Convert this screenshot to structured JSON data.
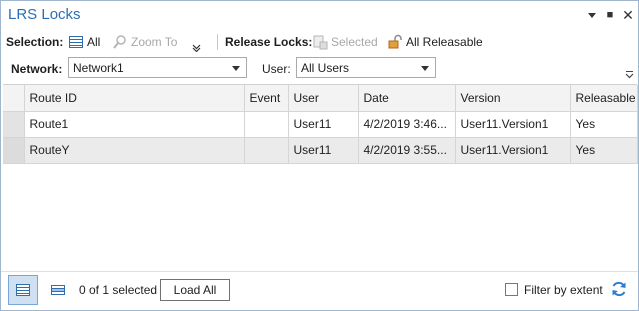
{
  "window": {
    "title": "LRS Locks",
    "pin_glyph": "▾",
    "restore_glyph": "■",
    "close_glyph": "✕"
  },
  "toolbar": {
    "selection_label": "Selection:",
    "all_label": "All",
    "zoom_to_label": "Zoom To",
    "release_locks_label": "Release Locks:",
    "selected_label": "Selected",
    "all_releasable_label": "All Releasable"
  },
  "filters": {
    "network_label": "Network:",
    "network_value": "Network1",
    "user_label": "User:",
    "user_value": "All Users"
  },
  "table": {
    "columns": [
      "Route ID",
      "Event",
      "User",
      "Date",
      "Version",
      "Releasable"
    ],
    "rows": [
      {
        "route_id": "Route1",
        "event": "",
        "user": "User11",
        "date": "4/2/2019   3:46...",
        "version": "User11.Version1",
        "releasable": "Yes"
      },
      {
        "route_id": "RouteY",
        "event": "",
        "user": "User11",
        "date": "4/2/2019   3:55...",
        "version": "User11.Version1",
        "releasable": "Yes"
      }
    ]
  },
  "footer": {
    "selection_count": "0 of 1 selected",
    "load_all_label": "Load All",
    "filter_by_extent_label": "Filter by extent",
    "filter_by_extent_checked": false
  },
  "icons": {
    "table_view": "table-view-icon",
    "list_view": "list-view-icon",
    "refresh": "refresh-icon",
    "lock": "lock-icon"
  },
  "colors": {
    "title": "#2a6fb3",
    "accent": "#2f7fd0",
    "lock": "#c8741c",
    "active_view": "#cfe0f2"
  }
}
